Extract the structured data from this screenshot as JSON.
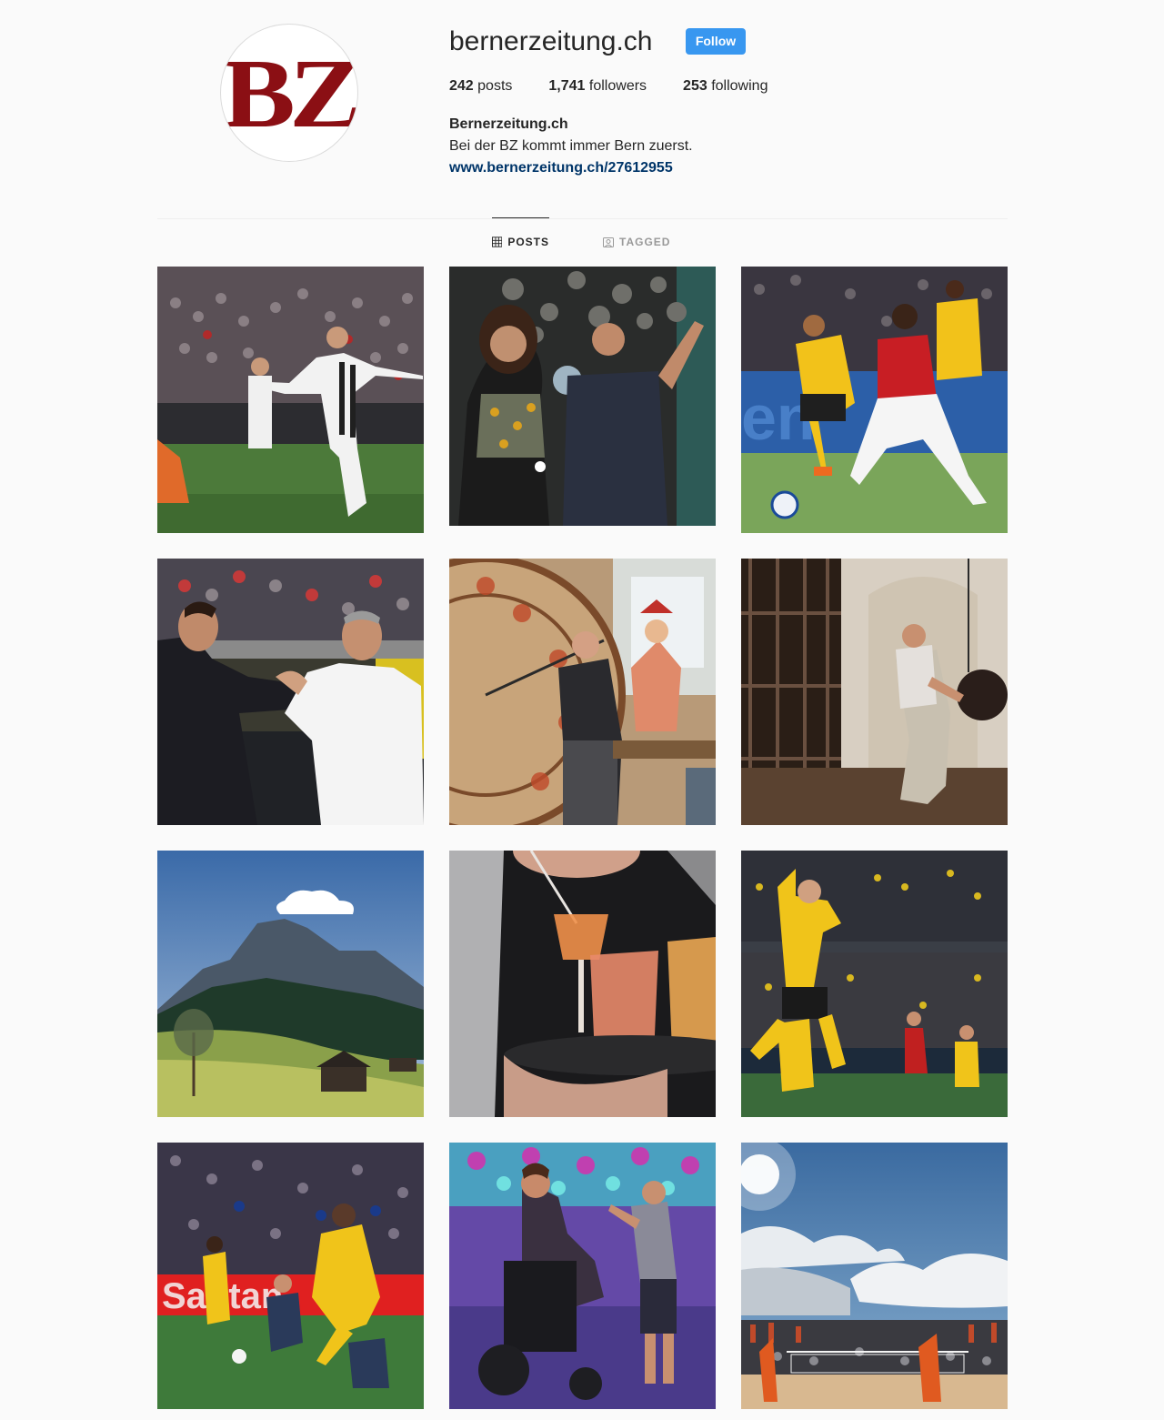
{
  "profile": {
    "username": "bernerzeitung.ch",
    "follow_label": "Follow",
    "avatar_text": "BZ",
    "stats": {
      "posts_count": "242",
      "posts_label": "posts",
      "followers_count": "1,741",
      "followers_label": "followers",
      "following_count": "253",
      "following_label": "following"
    },
    "bio": {
      "name": "Bernerzeitung.ch",
      "text": "Bei der BZ kommt immer Bern zuerst.",
      "link": "www.bernerzeitung.ch/27612955"
    }
  },
  "tabs": {
    "posts": "POSTS",
    "tagged": "TAGGED",
    "active": "posts"
  },
  "colors": {
    "accent": "#3897f0",
    "link": "#003569",
    "brand": "#8b0f14"
  },
  "posts": [
    {
      "subject": "football-celebration-stadium"
    },
    {
      "subject": "portrait-two-people-disco-balls"
    },
    {
      "subject": "football-match-yellow-vs-red"
    },
    {
      "subject": "coaches-handshake-stadium"
    },
    {
      "subject": "man-with-astronomical-clock-figure"
    },
    {
      "subject": "man-pushing-clock-weight"
    },
    {
      "subject": "mountain-landscape-hut"
    },
    {
      "subject": "waitress-with-drinks-tray"
    },
    {
      "subject": "football-player-jumping-celebration"
    },
    {
      "subject": "football-match-night-stadium"
    },
    {
      "subject": "dance-party-wheelchair"
    },
    {
      "subject": "beach-volleyball-stadium-sky"
    }
  ]
}
